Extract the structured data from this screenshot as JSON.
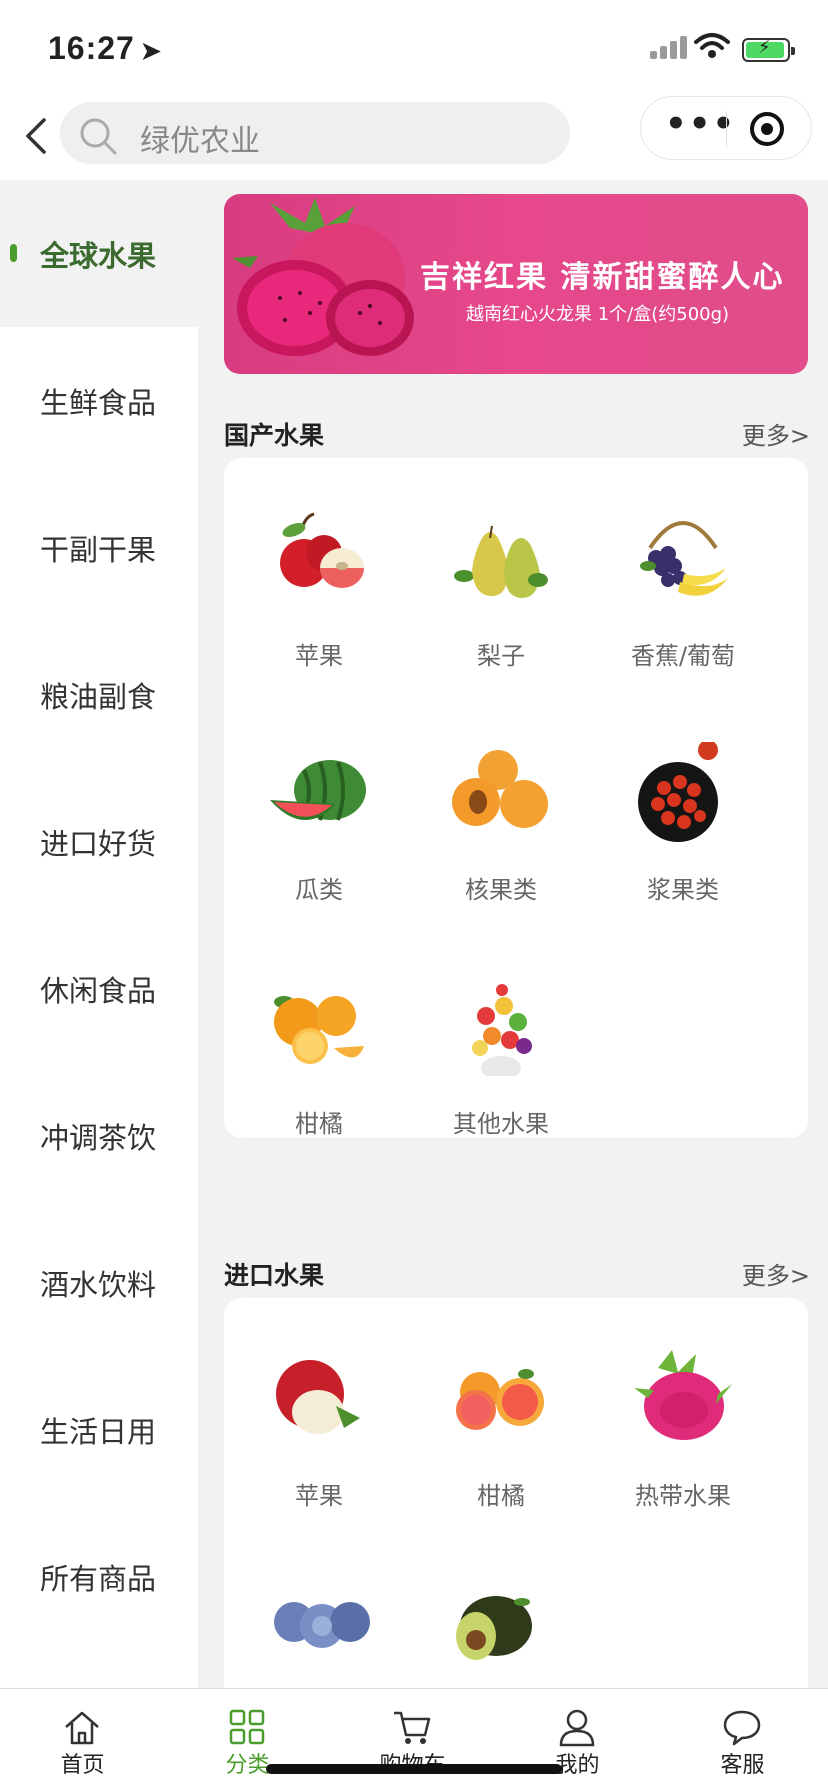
{
  "status": {
    "time": "16:27"
  },
  "search": {
    "placeholder": "绿优农业"
  },
  "sidebar": {
    "items": [
      {
        "label": "全球水果"
      },
      {
        "label": "生鲜食品"
      },
      {
        "label": "干副干果"
      },
      {
        "label": "粮油副食"
      },
      {
        "label": "进口好货"
      },
      {
        "label": "休闲食品"
      },
      {
        "label": "冲调茶饮"
      },
      {
        "label": "酒水饮料"
      },
      {
        "label": "生活日用"
      },
      {
        "label": "所有商品"
      }
    ]
  },
  "banner": {
    "headline": "吉祥红果  清新甜蜜醉人心",
    "subline": "越南红心火龙果 1个/盒(约500g)"
  },
  "domestic": {
    "title": "国产水果",
    "more": "更多>",
    "items": [
      {
        "label": "苹果"
      },
      {
        "label": "梨子"
      },
      {
        "label": "香蕉/葡萄"
      },
      {
        "label": "瓜类"
      },
      {
        "label": "核果类"
      },
      {
        "label": "浆果类"
      },
      {
        "label": "柑橘"
      },
      {
        "label": "其他水果"
      }
    ]
  },
  "imported": {
    "title": "进口水果",
    "more": "更多>",
    "items": [
      {
        "label": "苹果"
      },
      {
        "label": "柑橘"
      },
      {
        "label": "热带水果"
      }
    ]
  },
  "tabbar": {
    "items": [
      {
        "label": "首页"
      },
      {
        "label": "分类"
      },
      {
        "label": "购物车"
      },
      {
        "label": "我的"
      },
      {
        "label": "客服"
      }
    ]
  },
  "colors": {
    "accent": "#4a9d2c",
    "banner": "#e6488b"
  }
}
